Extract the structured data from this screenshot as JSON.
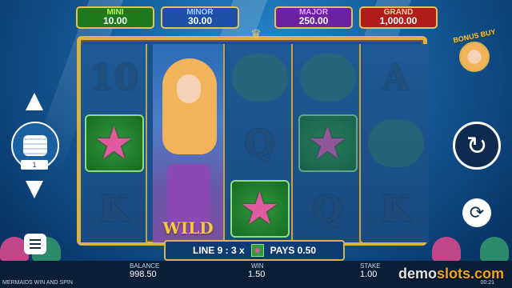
{
  "jackpots": {
    "mini": {
      "label": "MINI",
      "value": "10.00"
    },
    "minor": {
      "label": "MINOR",
      "value": "30.00"
    },
    "major": {
      "label": "MAJOR",
      "value": "250.00"
    },
    "grand": {
      "label": "GRAND",
      "value": "1,000.00"
    }
  },
  "reels": {
    "r1": {
      "top": "10",
      "bottom": "K"
    },
    "r3": {
      "middle": "Q"
    },
    "r4": {
      "bottom": "Q"
    },
    "r5": {
      "top": "A",
      "bottom": "K"
    },
    "wild_label": "WILD"
  },
  "win_bar": {
    "line": "LINE 9 : 3 x",
    "pays": "PAYS 0.50"
  },
  "controls": {
    "bet_level": "1",
    "bonus_buy_label": "BONUS BUY",
    "spin_icon": "refresh-icon",
    "autoplay_icon": "autoplay-icon",
    "menu_icon": "hamburger-menu-icon"
  },
  "bottom_bar": {
    "balance_label": "BALANCE",
    "balance_value": "998.50",
    "win_label": "WIN",
    "win_value": "1.50",
    "stake_label": "STAKE",
    "stake_value": "1.00",
    "game_name": "MERMAIDS WIN AND SPIN",
    "clock": "00:21"
  },
  "watermark": {
    "prefix": "demo",
    "suffix": "slots.com"
  },
  "colors": {
    "gold": "#d9b24a",
    "mini": "#1c7a1c",
    "minor": "#1d4fa8",
    "major": "#6a22a3",
    "grand": "#b11d1d"
  }
}
